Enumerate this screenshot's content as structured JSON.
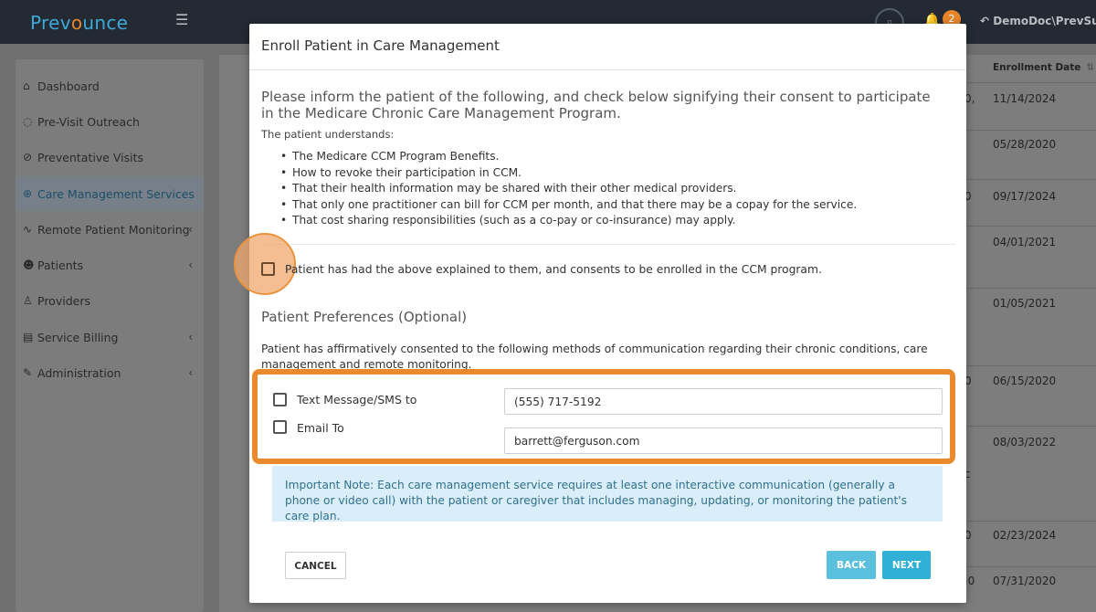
{
  "app": {
    "logo_prefix": "Prev",
    "logo_o": "o",
    "logo_suffix": "unce",
    "notification_count": "2",
    "user": "DemoDoc\\PrevSup"
  },
  "sidebar": {
    "items": [
      {
        "label": "Dashboard",
        "icon": "home-icon"
      },
      {
        "label": "Pre-Visit Outreach",
        "icon": "chat-icon"
      },
      {
        "label": "Preventative Visits",
        "icon": "check-circle-icon"
      },
      {
        "label": "Care Management Services",
        "icon": "care-icon",
        "active": true
      },
      {
        "label": "Remote Patient Monitoring",
        "icon": "wave-icon",
        "expandable": true
      },
      {
        "label": "Patients",
        "icon": "users-icon",
        "expandable": true
      },
      {
        "label": "Providers",
        "icon": "user-icon"
      },
      {
        "label": "Service Billing",
        "icon": "invoice-icon",
        "expandable": true
      },
      {
        "label": "Administration",
        "icon": "wrench-icon",
        "expandable": true
      }
    ]
  },
  "table": {
    "header": "Enrollment Date",
    "dates": [
      "11/14/2024",
      "05/28/2020",
      "09/17/2024",
      "04/01/2021",
      "01/05/2021",
      "06/15/2020",
      "08/03/2022",
      "02/23/2024",
      "07/31/2020"
    ],
    "fragments": [
      "0,",
      "0",
      "0",
      "c",
      "0",
      "50"
    ]
  },
  "modal": {
    "title": "Enroll Patient in Care Management",
    "lead": "Please inform the patient of the following, and check below signifying their consent to participate in the Medicare Chronic Care Management Program.",
    "understands": "The patient understands:",
    "bullets": [
      "The Medicare CCM Program Benefits.",
      "How to revoke their participation in CCM.",
      "That their health information may be shared with their other medical providers.",
      "That only one practitioner can bill for CCM per month, and that there may be a copay for the service.",
      "That cost sharing responsibilities (such as a co-pay or co-insurance) may apply."
    ],
    "consent_label": "Patient has had the above explained to them, and consents to be enrolled in the CCM program.",
    "prefs_title": "Patient Preferences (Optional)",
    "prefs_desc": "Patient has affirmatively consented to the following methods of communication regarding their chronic conditions, care management and remote monitoring.",
    "sms_label": "Text Message/SMS to",
    "sms_value": "(555) 717-5192",
    "email_label": "Email To",
    "email_value": "barrett@ferguson.com",
    "note": "Important Note: Each care management service requires at least one interactive communication (generally a phone or video call) with the patient or caregiver that includes managing, updating, or monitoring the patient's care plan.",
    "cancel": "CANCEL",
    "back": "BACK",
    "next": "NEXT"
  },
  "colors": {
    "accent_orange": "#ea8a2c",
    "button_blue": "#31b0d5",
    "note_bg": "#d9eef8",
    "note_text": "#31708f"
  }
}
